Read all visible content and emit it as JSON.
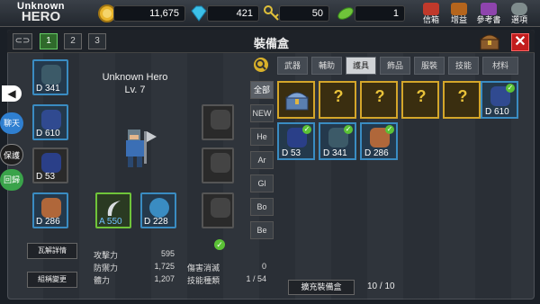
{
  "header": {
    "title_line1": "Unknown",
    "title_line2": "HERO",
    "gold": "11,675",
    "gems": "421",
    "keys": "50",
    "leaves": "1",
    "menu": [
      {
        "label": "信箱",
        "icon": "mail-icon"
      },
      {
        "label": "增益",
        "icon": "buff-icon"
      },
      {
        "label": "參考書",
        "icon": "book-icon"
      },
      {
        "label": "選項",
        "icon": "gear-icon"
      }
    ]
  },
  "loadout": {
    "buttons": [
      "1",
      "2",
      "3"
    ],
    "active": "1"
  },
  "equipment_box": {
    "title": "裝備盒",
    "close": "✕"
  },
  "left_equipment": [
    {
      "label": "D 341",
      "icon": "helmet-icon"
    },
    {
      "label": "D 610",
      "icon": "armor-icon"
    },
    {
      "label": "D 53",
      "icon": "gauntlet-icon"
    },
    {
      "label": "D 286",
      "icon": "boots-icon"
    }
  ],
  "side_buttons": [
    {
      "label": "聊天",
      "icon": "chat-icon"
    },
    {
      "label": "保護",
      "icon": "shield-icon"
    },
    {
      "label": "回歸",
      "icon": "return-icon"
    }
  ],
  "hero": {
    "name": "Unknown Hero",
    "level": "Lv. 7"
  },
  "weapons": [
    {
      "label": "A 550",
      "icon": "scythe-icon"
    },
    {
      "label": "D 228",
      "icon": "shield-icon"
    }
  ],
  "stats": {
    "attack_label": "攻擊力",
    "attack": "595",
    "defense_label": "防禦力",
    "defense": "1,725",
    "hp_label": "體力",
    "hp": "1,207",
    "dmg_reduce_label": "傷害消滅",
    "dmg_reduce": "0",
    "skill_label": "技能種類",
    "skill": "1 / 54"
  },
  "actions": {
    "dismantle": "瓦解詳情",
    "rename": "組稱變更"
  },
  "tabs": [
    "武器",
    "輔助",
    "護具",
    "飾品",
    "服裝",
    "技能",
    "材料"
  ],
  "active_tab": "護具",
  "filters": [
    "全部",
    "NEW",
    "He",
    "Ar",
    "Gl",
    "Bo",
    "Be"
  ],
  "items": [
    {
      "label": "",
      "type": "chest",
      "icon": "chest-icon"
    },
    {
      "label": "",
      "type": "unknown",
      "icon": "helmet-unknown-icon"
    },
    {
      "label": "",
      "type": "unknown",
      "icon": "armor-unknown-icon"
    },
    {
      "label": "",
      "type": "unknown",
      "icon": "glove-unknown-icon"
    },
    {
      "label": "",
      "type": "unknown",
      "icon": "boot-unknown-icon"
    },
    {
      "label": "D 610",
      "type": "equipped",
      "icon": "armor-icon"
    },
    {
      "label": "D 53",
      "type": "equipped",
      "icon": "gauntlet-icon"
    },
    {
      "label": "D 341",
      "type": "equipped",
      "icon": "helmet-icon"
    },
    {
      "label": "D 286",
      "type": "equipped",
      "icon": "boots-icon"
    }
  ],
  "footer": {
    "expand": "擴充裝備盒",
    "count": "10 / 10"
  },
  "colors": {
    "gold_border": "#d4a62a",
    "blue_border": "#3a8cc2",
    "check": "#5bc236",
    "close": "#c21d1d"
  }
}
